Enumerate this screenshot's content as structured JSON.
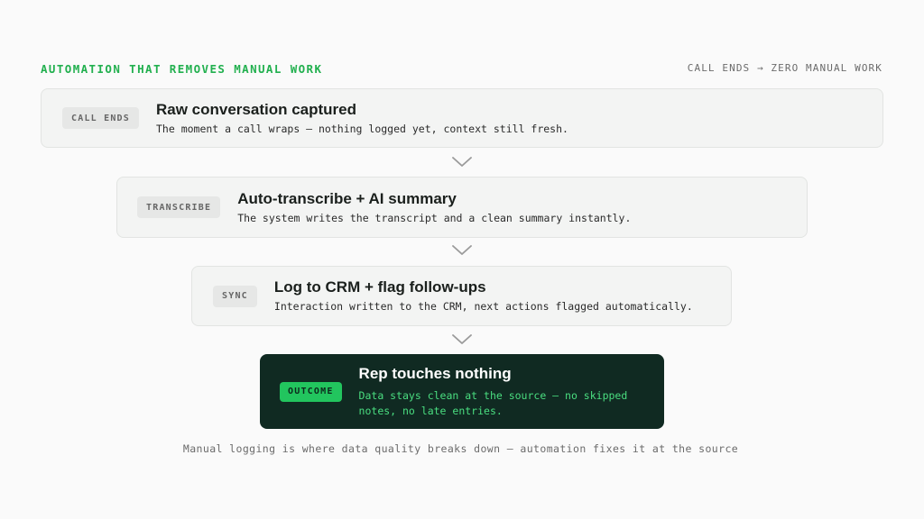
{
  "header": {
    "title": "AUTOMATION THAT REMOVES MANUAL WORK",
    "flow_summary": "CALL ENDS → ZERO MANUAL WORK"
  },
  "steps": [
    {
      "badge": "CALL ENDS",
      "title": "Raw conversation captured",
      "description": "The moment a call wraps — nothing logged yet, context still fresh."
    },
    {
      "badge": "TRANSCRIBE",
      "title": "Auto-transcribe + AI summary",
      "description": "The system writes the transcript and a clean summary instantly."
    },
    {
      "badge": "SYNC",
      "title": "Log to CRM + flag follow-ups",
      "description": "Interaction written to the CRM, next actions flagged automatically."
    }
  ],
  "outcome": {
    "badge": "OUTCOME",
    "title": "Rep touches nothing",
    "description": "Data stays clean at the source — no skipped notes, no late entries."
  },
  "footer": "Manual logging is where data quality breaks down — automation fixes it at the source",
  "colors": {
    "accent": "#22b04f",
    "outcome_bg": "#102a22",
    "outcome_badge": "#22c55e",
    "outcome_text": "#4ade80"
  },
  "icons": [
    "chevron-down-icon"
  ]
}
